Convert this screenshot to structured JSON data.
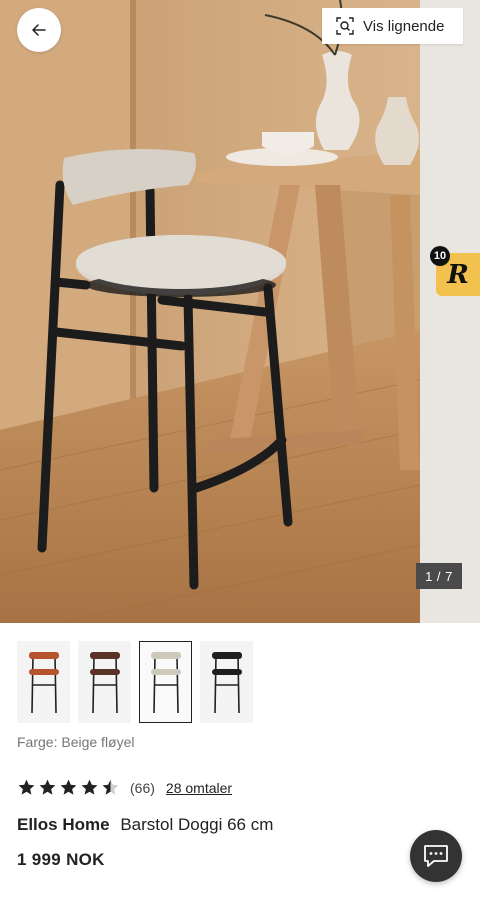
{
  "hero": {
    "similar_label": "Vis lignende",
    "counter": "1 / 7",
    "rewards_count": "10",
    "rewards_logo": "R"
  },
  "swatches": [
    {
      "name": "rust",
      "seat_color": "#b5532f"
    },
    {
      "name": "brown",
      "seat_color": "#5a3327"
    },
    {
      "name": "beige",
      "seat_color": "#cfc8bd",
      "selected": true
    },
    {
      "name": "black",
      "seat_color": "#1e1e1e"
    }
  ],
  "product": {
    "color_label": "Farge: Beige fløyel",
    "rating_value": 4.5,
    "rating_count": "(66)",
    "reviews_label": "28 omtaler",
    "brand": "Ellos Home",
    "name": "Barstol Doggi 66 cm",
    "price": "1 999 NOK"
  },
  "icons": {
    "back": "arrow-left-icon",
    "similar": "visual-search-icon",
    "chat": "chat-icon"
  },
  "colors": {
    "star": "#222222",
    "chat_bg": "#333333",
    "rewards_bg": "#f2c14e"
  }
}
